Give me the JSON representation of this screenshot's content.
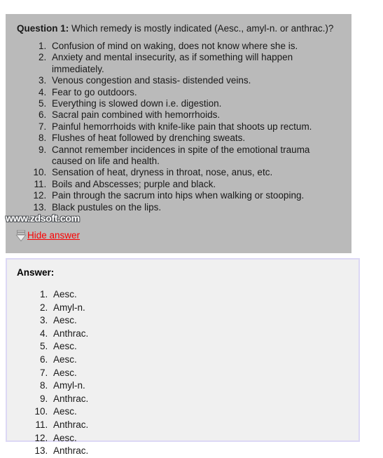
{
  "question": {
    "label": "Question 1:",
    "text": " Which remedy is mostly indicated (Aesc., amyl-n. or anthrac.)?",
    "symptoms": [
      "Confusion of mind on waking, does not know where she is.",
      "Anxiety and mental insecurity, as if something will happen immediately.",
      "Venous congestion and stasis- distended veins.",
      "Fear to go outdoors.",
      "Everything is slowed down i.e. digestion.",
      "Sacral pain combined with hemorrhoids.",
      "Painful hemorrhoids with knife-like pain that shoots up rectum.",
      "Flushes of heat followed by drenching sweats.",
      "Cannot remember incidences in spite of the emotional trauma caused on life and health.",
      "Sensation of heat, dryness in throat, nose, anus, etc.",
      "Boils and Abscesses; purple and black.",
      "Pain through the sacrum into hips when walking or stooping.",
      "Black pustules on the lips."
    ]
  },
  "toggle": {
    "label": "Hide answer",
    "icon": "down-arrow-icon",
    "color": "#fa0000"
  },
  "watermark": {
    "text": "www.zdsoft.com"
  },
  "answer": {
    "heading": "Answer:",
    "items": [
      "Aesc.",
      "Amyl-n.",
      "Aesc.",
      "Anthrac.",
      "Aesc.",
      "Aesc.",
      "Aesc.",
      "Amyl-n.",
      "Anthrac.",
      "Aesc.",
      "Anthrac.",
      "Aesc.",
      "Anthrac."
    ]
  },
  "colors": {
    "question_background": "#bababa",
    "answer_background": "#f0f0f0",
    "answer_border": "#dcd8f5",
    "link": "#fa0000",
    "page_background": "#ffffff"
  }
}
